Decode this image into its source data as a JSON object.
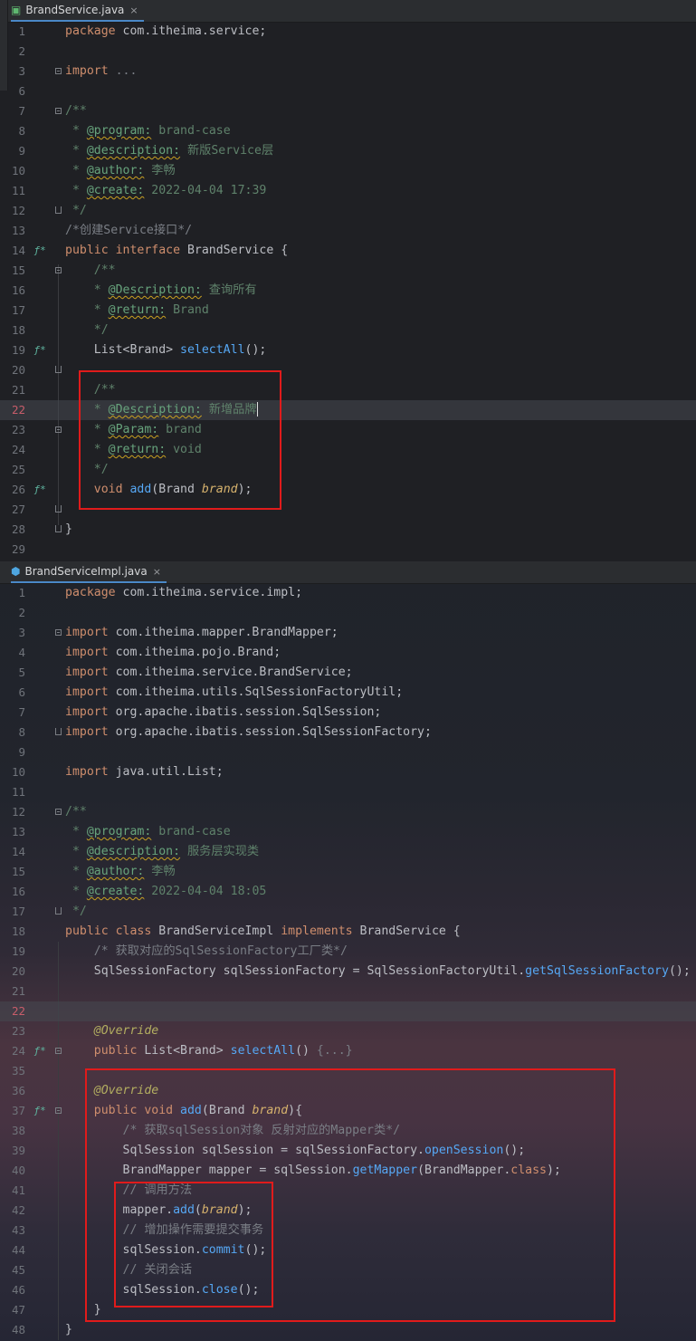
{
  "editor1": {
    "tab": {
      "name": "BrandService.java",
      "close": "×"
    },
    "lines": [
      {
        "n": "1",
        "g": "",
        "seg": [
          [
            "kw",
            "package "
          ],
          [
            "cl",
            "com.itheima.service;"
          ]
        ]
      },
      {
        "n": "2",
        "g": "",
        "seg": []
      },
      {
        "n": "3",
        "g": "",
        "seg": [
          [
            "kw",
            "import "
          ],
          [
            "cm",
            "..."
          ]
        ]
      },
      {
        "n": "6",
        "g": "",
        "seg": []
      },
      {
        "n": "7",
        "g": "",
        "seg": [
          [
            "jd",
            "/**"
          ]
        ]
      },
      {
        "n": "8",
        "g": "",
        "seg": [
          [
            "jd",
            " * "
          ],
          [
            "jt",
            "@program:"
          ],
          [
            "jd",
            " brand-case"
          ]
        ]
      },
      {
        "n": "9",
        "g": "",
        "seg": [
          [
            "jd",
            " * "
          ],
          [
            "jt",
            "@description:"
          ],
          [
            "jd",
            " 新版Service层"
          ]
        ]
      },
      {
        "n": "10",
        "g": "",
        "seg": [
          [
            "jd",
            " * "
          ],
          [
            "jt",
            "@author:"
          ],
          [
            "jd",
            " 李畅"
          ]
        ]
      },
      {
        "n": "11",
        "g": "",
        "seg": [
          [
            "jd",
            " * "
          ],
          [
            "jt",
            "@create:"
          ],
          [
            "jd",
            " 2022-04-04 17:39"
          ]
        ]
      },
      {
        "n": "12",
        "g": "",
        "seg": [
          [
            "jd",
            " */"
          ]
        ]
      },
      {
        "n": "13",
        "g": "",
        "seg": [
          [
            "cm",
            "/*创建Service接口*/"
          ]
        ]
      },
      {
        "n": "14",
        "g": "impl",
        "seg": [
          [
            "kw",
            "public interface "
          ],
          [
            "cl",
            "BrandService {"
          ]
        ]
      },
      {
        "n": "15",
        "g": "",
        "seg": [
          [
            "jd",
            "    /**"
          ]
        ]
      },
      {
        "n": "16",
        "g": "",
        "seg": [
          [
            "jd",
            "    * "
          ],
          [
            "jt",
            "@Description:"
          ],
          [
            "jd",
            " 查询所有"
          ]
        ]
      },
      {
        "n": "17",
        "g": "",
        "seg": [
          [
            "jd",
            "    * "
          ],
          [
            "jt",
            "@return:"
          ],
          [
            "jd",
            " Brand"
          ]
        ]
      },
      {
        "n": "18",
        "g": "",
        "seg": [
          [
            "jd",
            "    */"
          ]
        ]
      },
      {
        "n": "19",
        "g": "impl",
        "seg": [
          [
            "cl",
            "    List<Brand> "
          ],
          [
            "fn",
            "selectAll"
          ],
          [
            "cl",
            "();"
          ]
        ]
      },
      {
        "n": "20",
        "g": "",
        "seg": []
      },
      {
        "n": "21",
        "g": "",
        "seg": [
          [
            "jd",
            "    /**"
          ]
        ]
      },
      {
        "n": "22",
        "g": "",
        "seg": [
          [
            "jd",
            "    * "
          ],
          [
            "jt",
            "@Description:"
          ],
          [
            "jd",
            " 新增品牌"
          ]
        ]
      },
      {
        "n": "23",
        "g": "",
        "seg": [
          [
            "jd",
            "    * "
          ],
          [
            "jt",
            "@Param:"
          ],
          [
            "jd",
            " brand"
          ]
        ]
      },
      {
        "n": "24",
        "g": "",
        "seg": [
          [
            "jd",
            "    * "
          ],
          [
            "jt",
            "@return:"
          ],
          [
            "jd",
            " void"
          ]
        ]
      },
      {
        "n": "25",
        "g": "",
        "seg": [
          [
            "jd",
            "    */"
          ]
        ]
      },
      {
        "n": "26",
        "g": "impl",
        "seg": [
          [
            "kw",
            "    void "
          ],
          [
            "fn",
            "add"
          ],
          [
            "cl",
            "(Brand "
          ],
          [
            "pm",
            "brand"
          ],
          [
            "cl",
            ");"
          ]
        ]
      },
      {
        "n": "27",
        "g": "",
        "seg": []
      },
      {
        "n": "28",
        "g": "",
        "seg": [
          [
            "cl",
            "}"
          ]
        ]
      },
      {
        "n": "29",
        "g": "",
        "seg": []
      }
    ]
  },
  "editor2": {
    "tab": {
      "name": "BrandServiceImpl.java",
      "close": "×"
    },
    "lines": [
      {
        "n": "1",
        "g": "",
        "seg": [
          [
            "kw",
            "package "
          ],
          [
            "cl",
            "com.itheima.service.impl;"
          ]
        ]
      },
      {
        "n": "2",
        "g": "",
        "seg": []
      },
      {
        "n": "3",
        "g": "",
        "seg": [
          [
            "kw",
            "import "
          ],
          [
            "cl",
            "com.itheima.mapper.BrandMapper;"
          ]
        ]
      },
      {
        "n": "4",
        "g": "",
        "seg": [
          [
            "kw",
            "import "
          ],
          [
            "cl",
            "com.itheima.pojo.Brand;"
          ]
        ]
      },
      {
        "n": "5",
        "g": "",
        "seg": [
          [
            "kw",
            "import "
          ],
          [
            "cl",
            "com.itheima.service.BrandService;"
          ]
        ]
      },
      {
        "n": "6",
        "g": "",
        "seg": [
          [
            "kw",
            "import "
          ],
          [
            "cl",
            "com.itheima.utils.SqlSessionFactoryUtil;"
          ]
        ]
      },
      {
        "n": "7",
        "g": "",
        "seg": [
          [
            "kw",
            "import "
          ],
          [
            "cl",
            "org.apache.ibatis.session.SqlSession;"
          ]
        ]
      },
      {
        "n": "8",
        "g": "",
        "seg": [
          [
            "kw",
            "import "
          ],
          [
            "cl",
            "org.apache.ibatis.session.SqlSessionFactory;"
          ]
        ]
      },
      {
        "n": "9",
        "g": "",
        "seg": []
      },
      {
        "n": "10",
        "g": "",
        "seg": [
          [
            "kw",
            "import "
          ],
          [
            "cl",
            "java.util.List;"
          ]
        ]
      },
      {
        "n": "11",
        "g": "",
        "seg": []
      },
      {
        "n": "12",
        "g": "",
        "seg": [
          [
            "jd",
            "/**"
          ]
        ]
      },
      {
        "n": "13",
        "g": "",
        "seg": [
          [
            "jd",
            " * "
          ],
          [
            "jt",
            "@program:"
          ],
          [
            "jd",
            " brand-case"
          ]
        ]
      },
      {
        "n": "14",
        "g": "",
        "seg": [
          [
            "jd",
            " * "
          ],
          [
            "jt",
            "@description:"
          ],
          [
            "jd",
            " 服务层实现类"
          ]
        ]
      },
      {
        "n": "15",
        "g": "",
        "seg": [
          [
            "jd",
            " * "
          ],
          [
            "jt",
            "@author:"
          ],
          [
            "jd",
            " 李畅"
          ]
        ]
      },
      {
        "n": "16",
        "g": "",
        "seg": [
          [
            "jd",
            " * "
          ],
          [
            "jt",
            "@create:"
          ],
          [
            "jd",
            " 2022-04-04 18:05"
          ]
        ]
      },
      {
        "n": "17",
        "g": "",
        "seg": [
          [
            "jd",
            " */"
          ]
        ]
      },
      {
        "n": "18",
        "g": "",
        "seg": [
          [
            "kw",
            "public class "
          ],
          [
            "cl",
            "BrandServiceImpl "
          ],
          [
            "kw",
            "implements "
          ],
          [
            "cl",
            "BrandService {"
          ]
        ]
      },
      {
        "n": "19",
        "g": "",
        "seg": [
          [
            "cm",
            "    /* 获取对应的SqlSessionFactory工厂类*/"
          ]
        ]
      },
      {
        "n": "20",
        "g": "",
        "seg": [
          [
            "cl",
            "    SqlSessionFactory sqlSessionFactory = SqlSessionFactoryUtil."
          ],
          [
            "fn",
            "getSqlSessionFactory"
          ],
          [
            "cl",
            "();"
          ]
        ]
      },
      {
        "n": "21",
        "g": "",
        "seg": []
      },
      {
        "n": "22",
        "g": "",
        "seg": []
      },
      {
        "n": "23",
        "g": "",
        "seg": [
          [
            "an",
            "    @Override"
          ]
        ]
      },
      {
        "n": "24",
        "g": "over",
        "seg": [
          [
            "kw",
            "    public "
          ],
          [
            "cl",
            "List<Brand> "
          ],
          [
            "fn",
            "selectAll"
          ],
          [
            "cl",
            "() "
          ],
          [
            "cm",
            "{...}"
          ]
        ]
      },
      {
        "n": "35",
        "g": "",
        "seg": []
      },
      {
        "n": "36",
        "g": "",
        "seg": [
          [
            "an",
            "    @Override"
          ]
        ]
      },
      {
        "n": "37",
        "g": "over",
        "seg": [
          [
            "kw",
            "    public void "
          ],
          [
            "fn",
            "add"
          ],
          [
            "cl",
            "(Brand "
          ],
          [
            "pm",
            "brand"
          ],
          [
            "cl",
            "){"
          ]
        ]
      },
      {
        "n": "38",
        "g": "",
        "seg": [
          [
            "cm",
            "        /* 获取sqlSession对象 反射对应的Mapper类*/"
          ]
        ]
      },
      {
        "n": "39",
        "g": "",
        "seg": [
          [
            "cl",
            "        SqlSession sqlSession = sqlSessionFactory."
          ],
          [
            "fn",
            "openSession"
          ],
          [
            "cl",
            "();"
          ]
        ]
      },
      {
        "n": "40",
        "g": "",
        "seg": [
          [
            "cl",
            "        BrandMapper mapper = sqlSession."
          ],
          [
            "fn",
            "getMapper"
          ],
          [
            "cl",
            "(BrandMapper."
          ],
          [
            "kw",
            "class"
          ],
          [
            "cl",
            ");"
          ]
        ]
      },
      {
        "n": "41",
        "g": "",
        "seg": [
          [
            "cm",
            "        // 调用方法"
          ]
        ]
      },
      {
        "n": "42",
        "g": "",
        "seg": [
          [
            "cl",
            "        mapper."
          ],
          [
            "fn",
            "add"
          ],
          [
            "cl",
            "("
          ],
          [
            "pm",
            "brand"
          ],
          [
            "cl",
            ");"
          ]
        ]
      },
      {
        "n": "43",
        "g": "",
        "seg": [
          [
            "cm",
            "        // 增加操作需要提交事务"
          ]
        ]
      },
      {
        "n": "44",
        "g": "",
        "seg": [
          [
            "cl",
            "        sqlSession."
          ],
          [
            "fn",
            "commit"
          ],
          [
            "cl",
            "();"
          ]
        ]
      },
      {
        "n": "45",
        "g": "",
        "seg": [
          [
            "cm",
            "        // 关闭会话"
          ]
        ]
      },
      {
        "n": "46",
        "g": "",
        "seg": [
          [
            "cl",
            "        sqlSession."
          ],
          [
            "fn",
            "close"
          ],
          [
            "cl",
            "();"
          ]
        ]
      },
      {
        "n": "47",
        "g": "",
        "seg": [
          [
            "cl",
            "    }"
          ]
        ]
      },
      {
        "n": "48",
        "g": "",
        "seg": [
          [
            "cl",
            "}"
          ]
        ]
      }
    ]
  }
}
